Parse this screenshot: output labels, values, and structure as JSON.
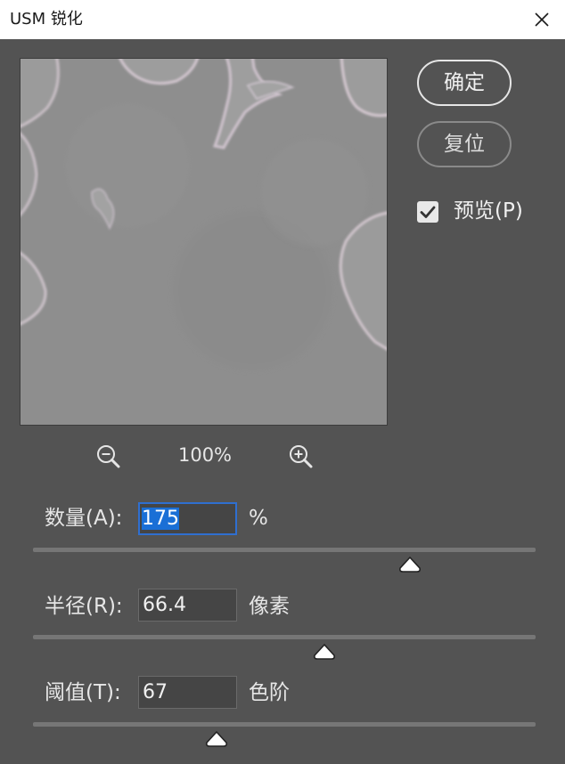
{
  "window": {
    "title": "USM 锐化"
  },
  "buttons": {
    "ok_label": "确定",
    "reset_label": "复位"
  },
  "preview_option": {
    "label": "预览(P)",
    "checked": true
  },
  "zoom": {
    "level": "100%"
  },
  "fields": [
    {
      "label": "数量(A):",
      "value": "175",
      "unit": "%",
      "slider_fraction": 0.75
    },
    {
      "label": "半径(R):",
      "value": "66.4",
      "unit": "像素",
      "slider_fraction": 0.58
    },
    {
      "label": "阈值(T):",
      "value": "67",
      "unit": "色阶",
      "slider_fraction": 0.365
    }
  ],
  "icons": {
    "close": "close-icon",
    "zoom_out": "zoom-out-icon",
    "zoom_in": "zoom-in-icon",
    "check": "check-icon",
    "slider": "slider-thumb-icon"
  },
  "colors": {
    "dialog_bg": "#535353",
    "focus_border": "#2f6fd0",
    "selection": "#1a6fd6"
  }
}
